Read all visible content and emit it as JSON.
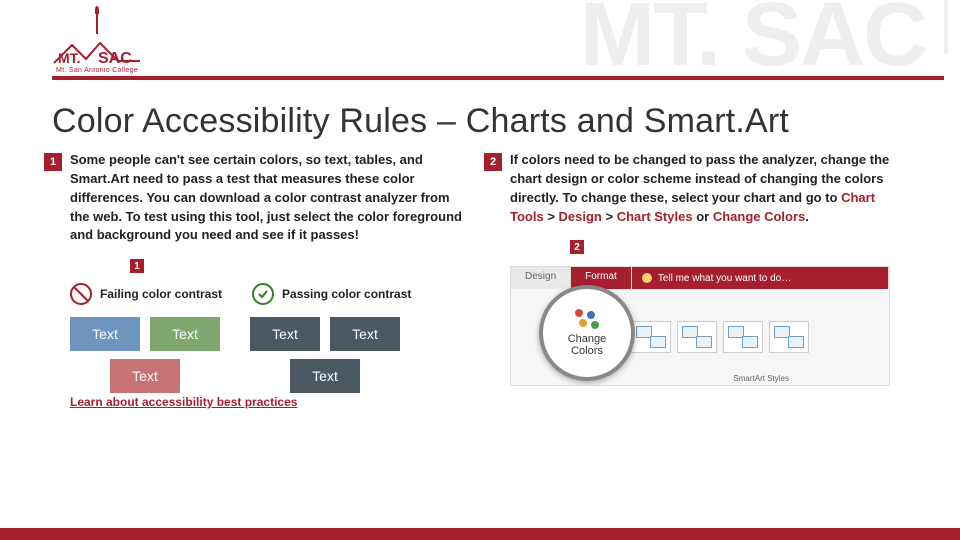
{
  "branding": {
    "college_name": "Mt. San Antonio College",
    "wordmark_prefix": "MT.",
    "wordmark_suffix": "SAC",
    "watermark": "MT. SAC"
  },
  "title": "Color Accessibility Rules – Charts and Smart.Art",
  "steps": [
    {
      "num": "1",
      "text": "Some people can't see certain colors, so text, tables, and Smart.Art need to pass a test that measures these color differences. You can download a color contrast analyzer from the web. To test using this tool, just select the color foreground and background you need and see if it passes!",
      "sub_num": "1"
    },
    {
      "num": "2",
      "text_before": "If colors need to be changed to pass the analyzer, change the chart design or color scheme instead of changing the colors directly. To change these, select your chart and go to ",
      "chain": [
        "Chart Tools",
        "Design",
        "Chart Styles",
        "Change Colors"
      ],
      "text_after": ".",
      "sub_num": "2"
    }
  ],
  "legend": {
    "fail": "Failing color contrast",
    "pass": "Passing color contrast"
  },
  "swatches": {
    "fail": [
      {
        "label": "Text",
        "bg": "#6e95bf"
      },
      {
        "label": "Text",
        "bg": "#7fa86f"
      },
      {
        "label": "Text",
        "bg": "#c77373"
      }
    ],
    "pass": [
      {
        "label": "Text",
        "bg": "#495861"
      },
      {
        "label": "Text",
        "bg": "#495861"
      },
      {
        "label": "Text",
        "bg": "#495861"
      }
    ],
    "fg": "#ffffff"
  },
  "ribbon": {
    "tabs": [
      "Design",
      "Format"
    ],
    "tell_me": "Tell me what you want to do…",
    "magnifier": {
      "line1": "Change",
      "line2": "Colors"
    },
    "group_label": "SmartArt Styles"
  },
  "link": "Learn about accessibility best practices"
}
